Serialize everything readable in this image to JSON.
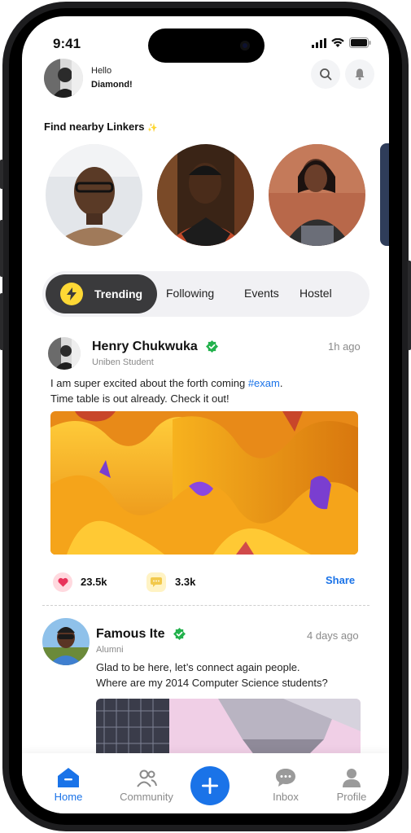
{
  "status_bar": {
    "time": "9:41"
  },
  "header": {
    "greeting_line1": "Hello",
    "greeting_line2": "Diamond!"
  },
  "nearby": {
    "title": "Find nearby Linkers"
  },
  "tabs": [
    {
      "label": "Trending",
      "active": true
    },
    {
      "label": "Following",
      "active": false
    },
    {
      "label": "Events",
      "active": false
    },
    {
      "label": "Hostel",
      "active": false
    }
  ],
  "posts": [
    {
      "name": "Henry Chukwuka",
      "subtitle": "Uniben Student",
      "time": "1h ago",
      "text_before": "I am super excited about the forth coming ",
      "hashtag": "#exam",
      "text_after": ".",
      "text_line2": "Time table is out already. Check it out!",
      "likes": "23.5k",
      "comments": "3.3k",
      "share_label": "Share"
    },
    {
      "name": "Famous Ite",
      "subtitle": "Alumni",
      "time": "4 days ago",
      "text_line1": "Glad to be here, let’s connect again people.",
      "text_line2": "Where are my 2014 Computer Science students?"
    }
  ],
  "nav": {
    "home": "Home",
    "community": "Community",
    "inbox": "Inbox",
    "profile": "Profile"
  },
  "colors": {
    "accent": "#1a73e8",
    "verified": "#22b14c",
    "tab_active": "#3a3a3c"
  }
}
